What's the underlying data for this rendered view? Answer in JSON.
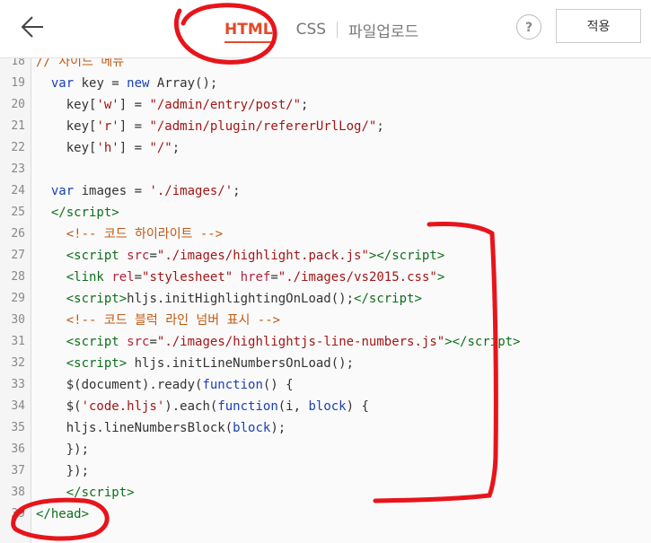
{
  "header": {
    "tabs": [
      {
        "label": "HTML",
        "active": true
      },
      {
        "label": "CSS",
        "active": false
      },
      {
        "label": "파일업로드",
        "active": false
      }
    ],
    "help_label": "?",
    "apply_label": "적용"
  },
  "editor": {
    "lines": [
      {
        "num": "18",
        "html": "<span class=\"cmt\">// 사이드 메뉴</span>"
      },
      {
        "num": "19",
        "html": "  <span class=\"kw\">var</span> key = <span class=\"kw\">new</span> Array();"
      },
      {
        "num": "20",
        "html": "    key[<span class=\"str\">'w'</span>] = <span class=\"str\">\"/admin/entry/post/\"</span>;"
      },
      {
        "num": "21",
        "html": "    key[<span class=\"str\">'r'</span>] = <span class=\"str\">\"/admin/plugin/refererUrlLog/\"</span>;"
      },
      {
        "num": "22",
        "html": "    key[<span class=\"str\">'h'</span>] = <span class=\"str\">\"/\"</span>;"
      },
      {
        "num": "23",
        "html": ""
      },
      {
        "num": "24",
        "html": "  <span class=\"kw\">var</span> images = <span class=\"str\">'./images/'</span>;"
      },
      {
        "num": "25",
        "html": "  <span class=\"tag\">&lt;/script&gt;</span>"
      },
      {
        "num": "26",
        "html": "    <span class=\"cmt\">&lt;!-- 코드 하이라이트 --&gt;</span>"
      },
      {
        "num": "27",
        "html": "    <span class=\"tag\">&lt;script</span> <span class=\"attr\">src</span>=<span class=\"str\">\"./images/highlight.pack.js\"</span><span class=\"tag\">&gt;&lt;/script&gt;</span>"
      },
      {
        "num": "28",
        "html": "    <span class=\"tag\">&lt;link</span> <span class=\"attr\">rel</span>=<span class=\"str\">\"stylesheet\"</span> <span class=\"attr\">href</span>=<span class=\"str\">\"./images/vs2015.css\"</span><span class=\"tag\">&gt;</span>"
      },
      {
        "num": "29",
        "html": "    <span class=\"tag\">&lt;script&gt;</span>hljs.initHighlightingOnLoad();<span class=\"tag\">&lt;/script&gt;</span>"
      },
      {
        "num": "30",
        "html": "    <span class=\"cmt\">&lt;!-- 코드 블럭 라인 넘버 표시 --&gt;</span>"
      },
      {
        "num": "31",
        "html": "    <span class=\"tag\">&lt;script</span> <span class=\"attr\">src</span>=<span class=\"str\">\"./images/highlightjs-line-numbers.js\"</span><span class=\"tag\">&gt;&lt;/script&gt;</span>"
      },
      {
        "num": "32",
        "html": "    <span class=\"tag\">&lt;script&gt;</span> hljs.initLineNumbersOnLoad();"
      },
      {
        "num": "33",
        "html": "    $(document).ready(<span class=\"kw\">function</span>() {"
      },
      {
        "num": "34",
        "html": "    $(<span class=\"str\">'code.hljs'</span>).each(<span class=\"kw\">function</span>(i, <span class=\"fn\">block</span>) {"
      },
      {
        "num": "35",
        "html": "    hljs.lineNumbersBlock(<span class=\"fn\">block</span>);"
      },
      {
        "num": "36",
        "html": "    });"
      },
      {
        "num": "37",
        "html": "    });"
      },
      {
        "num": "38",
        "html": "    <span class=\"tag\">&lt;/script&gt;</span>"
      },
      {
        "num": "39",
        "html": "<span class=\"tag\">&lt;/head&gt;</span>"
      }
    ]
  },
  "colors": {
    "accent": "#e14b2a",
    "annotation": "#e8141b"
  }
}
